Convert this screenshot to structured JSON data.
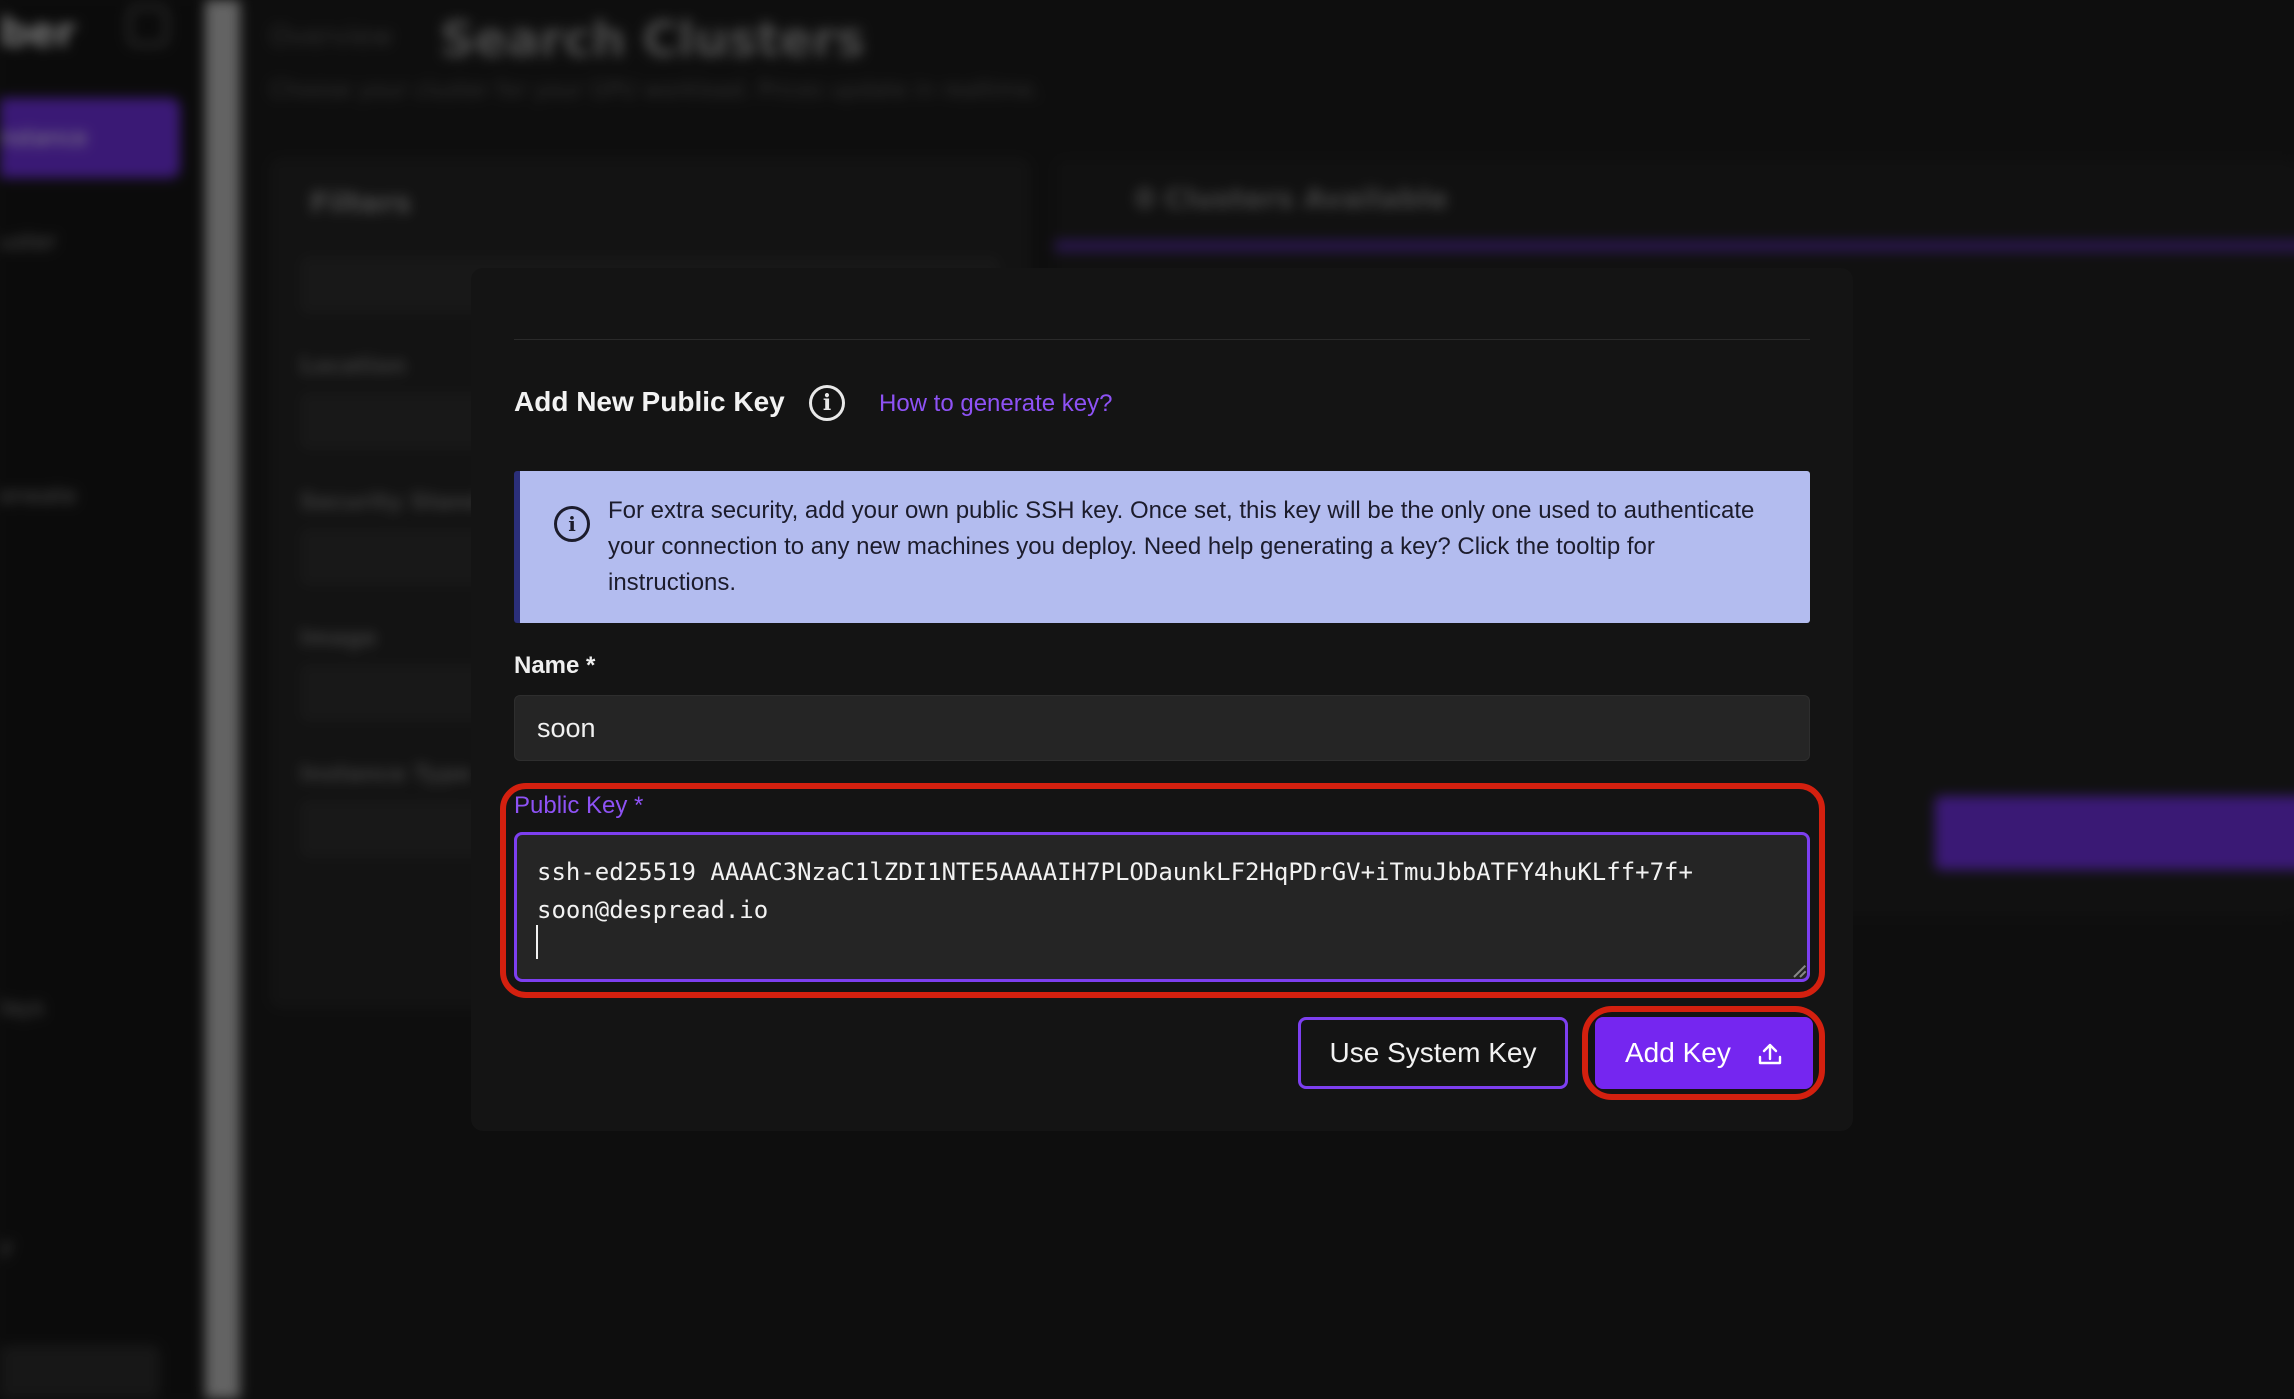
{
  "background": {
    "sidebar": {
      "brand": "ber",
      "active_item": "nstance",
      "nav_items": [
        "uster",
        "eneate",
        "lays",
        "y"
      ]
    },
    "breadcrumb": "Overview",
    "page_title": "Search Clusters",
    "page_subtitle": "Choose your cluster for your GPU workload. Prices update in realtime.",
    "filters_panel": {
      "title": "Filters",
      "labels": [
        "Location",
        "Security Standa",
        "Image",
        "Instance Type"
      ]
    },
    "clusters_panel": {
      "title": "0 Clusters Available"
    }
  },
  "modal": {
    "title": "Add New Public Key",
    "info_icon": "info-circle-icon",
    "help_link": "How to generate key?",
    "info_box": {
      "icon": "info-circle-icon",
      "text": "For extra security, add your own public SSH key. Once set, this key will be the only one used to authenticate your connection to any new machines you deploy. Need help generating a key? Click the tooltip for instructions."
    },
    "name_field": {
      "label": "Name *",
      "value": "soon"
    },
    "public_key_field": {
      "label": "Public Key *",
      "value": "ssh-ed25519 AAAAC3NzaC1lZDI1NTE5AAAAIH7PLODaunkLF2HqPDrGV+iTmuJbbATFY4huKLff+7f+\nsoon@despread.io"
    },
    "buttons": {
      "use_system_key": "Use System Key",
      "add_key": "Add Key",
      "add_key_icon": "upload-icon"
    }
  },
  "colors": {
    "accent": "#7526f0",
    "link": "#8e52f5",
    "highlight": "#d4200f",
    "info_bg": "#b3bcef"
  }
}
